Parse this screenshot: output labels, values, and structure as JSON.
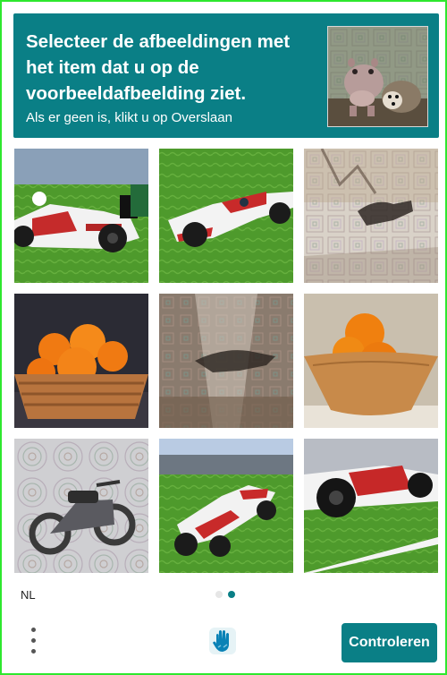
{
  "header": {
    "title": "Selecteer de afbeeldingen met het item dat u op de voorbeeldafbeelding ziet.",
    "subtitle": "Als er geen is, klikt u op Overslaan",
    "example_image": "hedgehog-and-hippo-photo"
  },
  "grid": {
    "tiles": [
      {
        "subject": "formula-1-car-photo"
      },
      {
        "subject": "formula-1-car-photo"
      },
      {
        "subject": "noisy-animal-silhouette"
      },
      {
        "subject": "basket-of-oranges-photo"
      },
      {
        "subject": "noisy-animal-silhouette"
      },
      {
        "subject": "bowl-of-oranges-photo"
      },
      {
        "subject": "noisy-motorcycle-photo"
      },
      {
        "subject": "formula-1-car-photo"
      },
      {
        "subject": "formula-1-car-photo"
      }
    ]
  },
  "footer": {
    "language": "NL",
    "page_indicator": {
      "total": 2,
      "current": 2
    },
    "verify_label": "Controleren",
    "menu_icon": "kebab-menu-icon",
    "logo_icon": "hcaptcha-hand-logo-icon"
  },
  "colors": {
    "accent": "#0a7f86",
    "frame": "#2ee82e"
  }
}
